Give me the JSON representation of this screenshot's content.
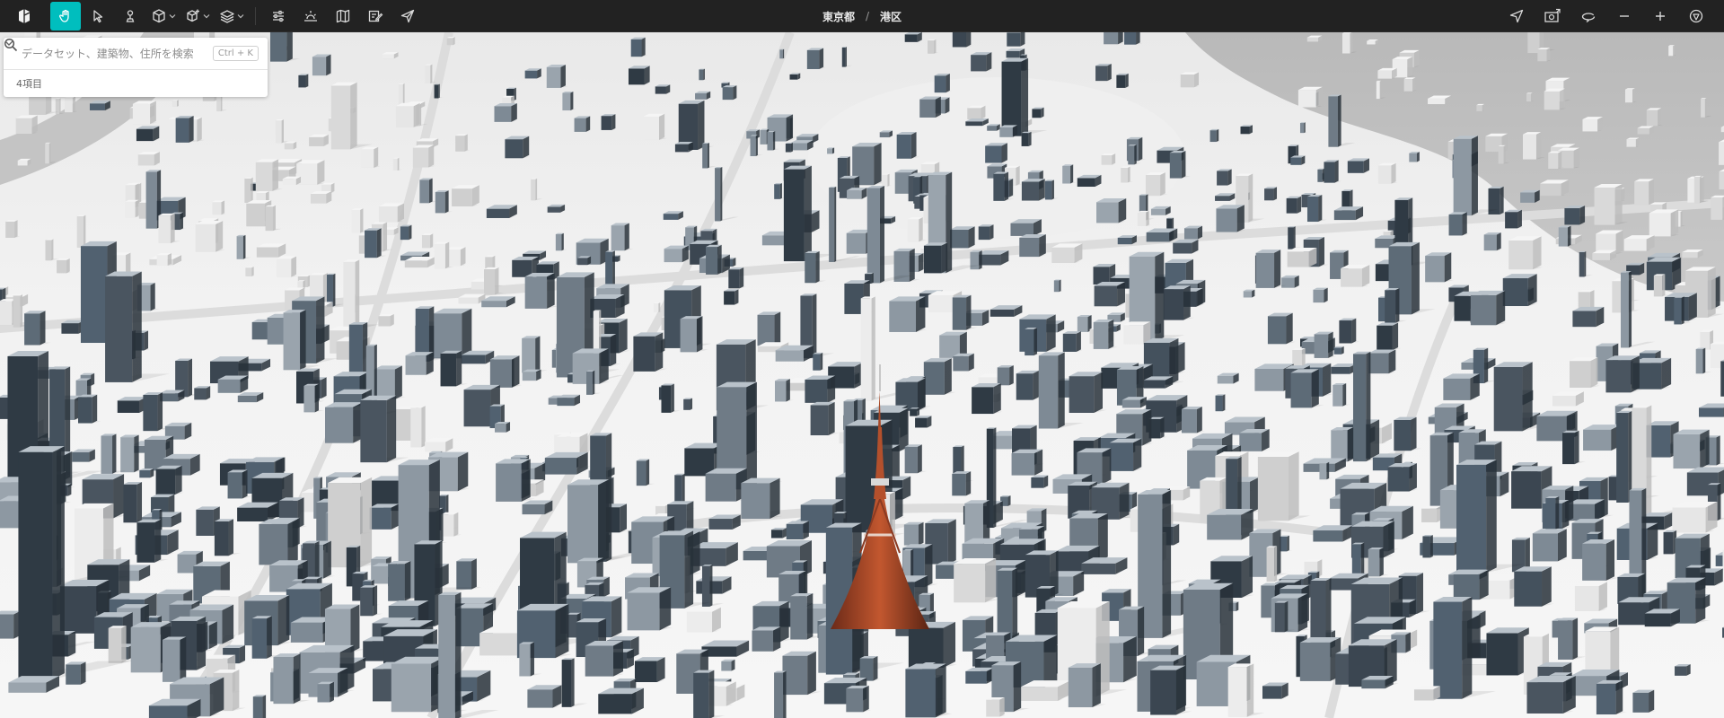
{
  "toolbar": {
    "tools": [
      {
        "icon": "hand-icon",
        "active": true
      },
      {
        "icon": "pointer-icon",
        "active": false
      },
      {
        "icon": "pin-icon",
        "active": false
      },
      {
        "icon": "cube-icon",
        "active": false
      },
      {
        "icon": "box-plus-icon",
        "active": false
      },
      {
        "icon": "layers-icon",
        "active": false
      }
    ],
    "accent_color": "#00bebe"
  },
  "breadcrumb": {
    "parent": "東京都",
    "separator": "/",
    "current": "港区"
  },
  "search": {
    "placeholder": "データセット、建築物、住所を検索",
    "shortcut": "Ctrl + K",
    "count_label": "4項目"
  }
}
